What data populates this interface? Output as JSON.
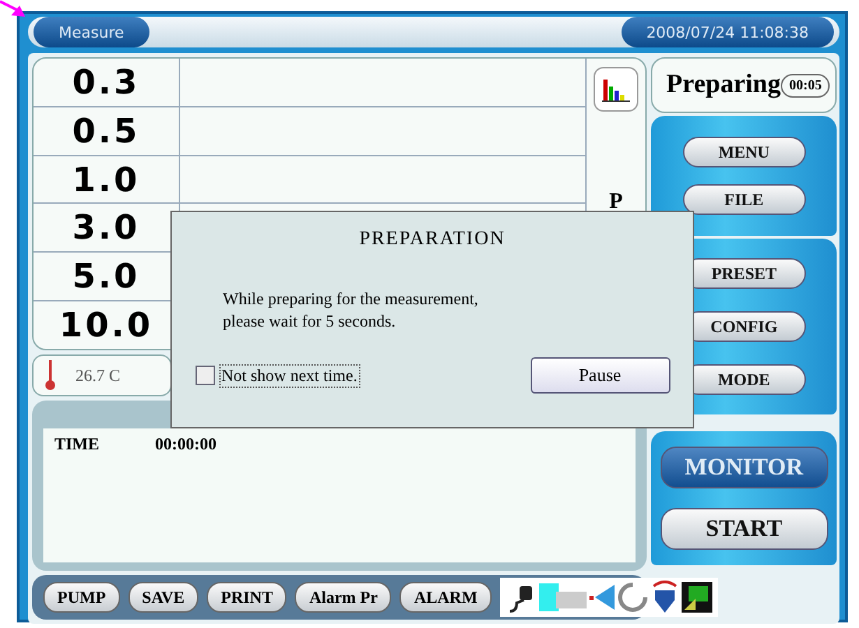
{
  "title_bar": {
    "mode": "Measure",
    "datetime": "2008/07/24 11:08:38"
  },
  "sizes": [
    {
      "label": "0.3"
    },
    {
      "label": "0.5"
    },
    {
      "label": "1.0"
    },
    {
      "label": "3.0"
    },
    {
      "label": "5.0"
    },
    {
      "label": "10.0"
    }
  ],
  "column_letter": "P",
  "temperature": "26.7 C",
  "log": {
    "rows": [
      {
        "label": "TIME",
        "value": "00:00:00"
      }
    ]
  },
  "status": {
    "label": "Preparing",
    "countdown": "00:05"
  },
  "menu_groups": [
    {
      "buttons": [
        {
          "label": "MENU",
          "selected": false
        },
        {
          "label": "FILE",
          "selected": false
        }
      ]
    },
    {
      "buttons": [
        {
          "label": "PRESET",
          "selected": false
        },
        {
          "label": "CONFIG",
          "selected": false
        },
        {
          "label": "MODE",
          "selected": false
        }
      ]
    },
    {
      "buttons": [
        {
          "label": "MONITOR",
          "selected": true
        },
        {
          "label": "START",
          "selected": false
        }
      ]
    }
  ],
  "toolbar": [
    "PUMP",
    "SAVE",
    "PRINT",
    "Alarm Pr",
    "ALARM"
  ],
  "dialog": {
    "title": "PREPARATION",
    "message_lines": [
      "While preparing for the measurement,",
      "please wait for 5 seconds."
    ],
    "checkbox": {
      "label": "Not show next time.",
      "checked": false
    },
    "button": "Pause"
  }
}
